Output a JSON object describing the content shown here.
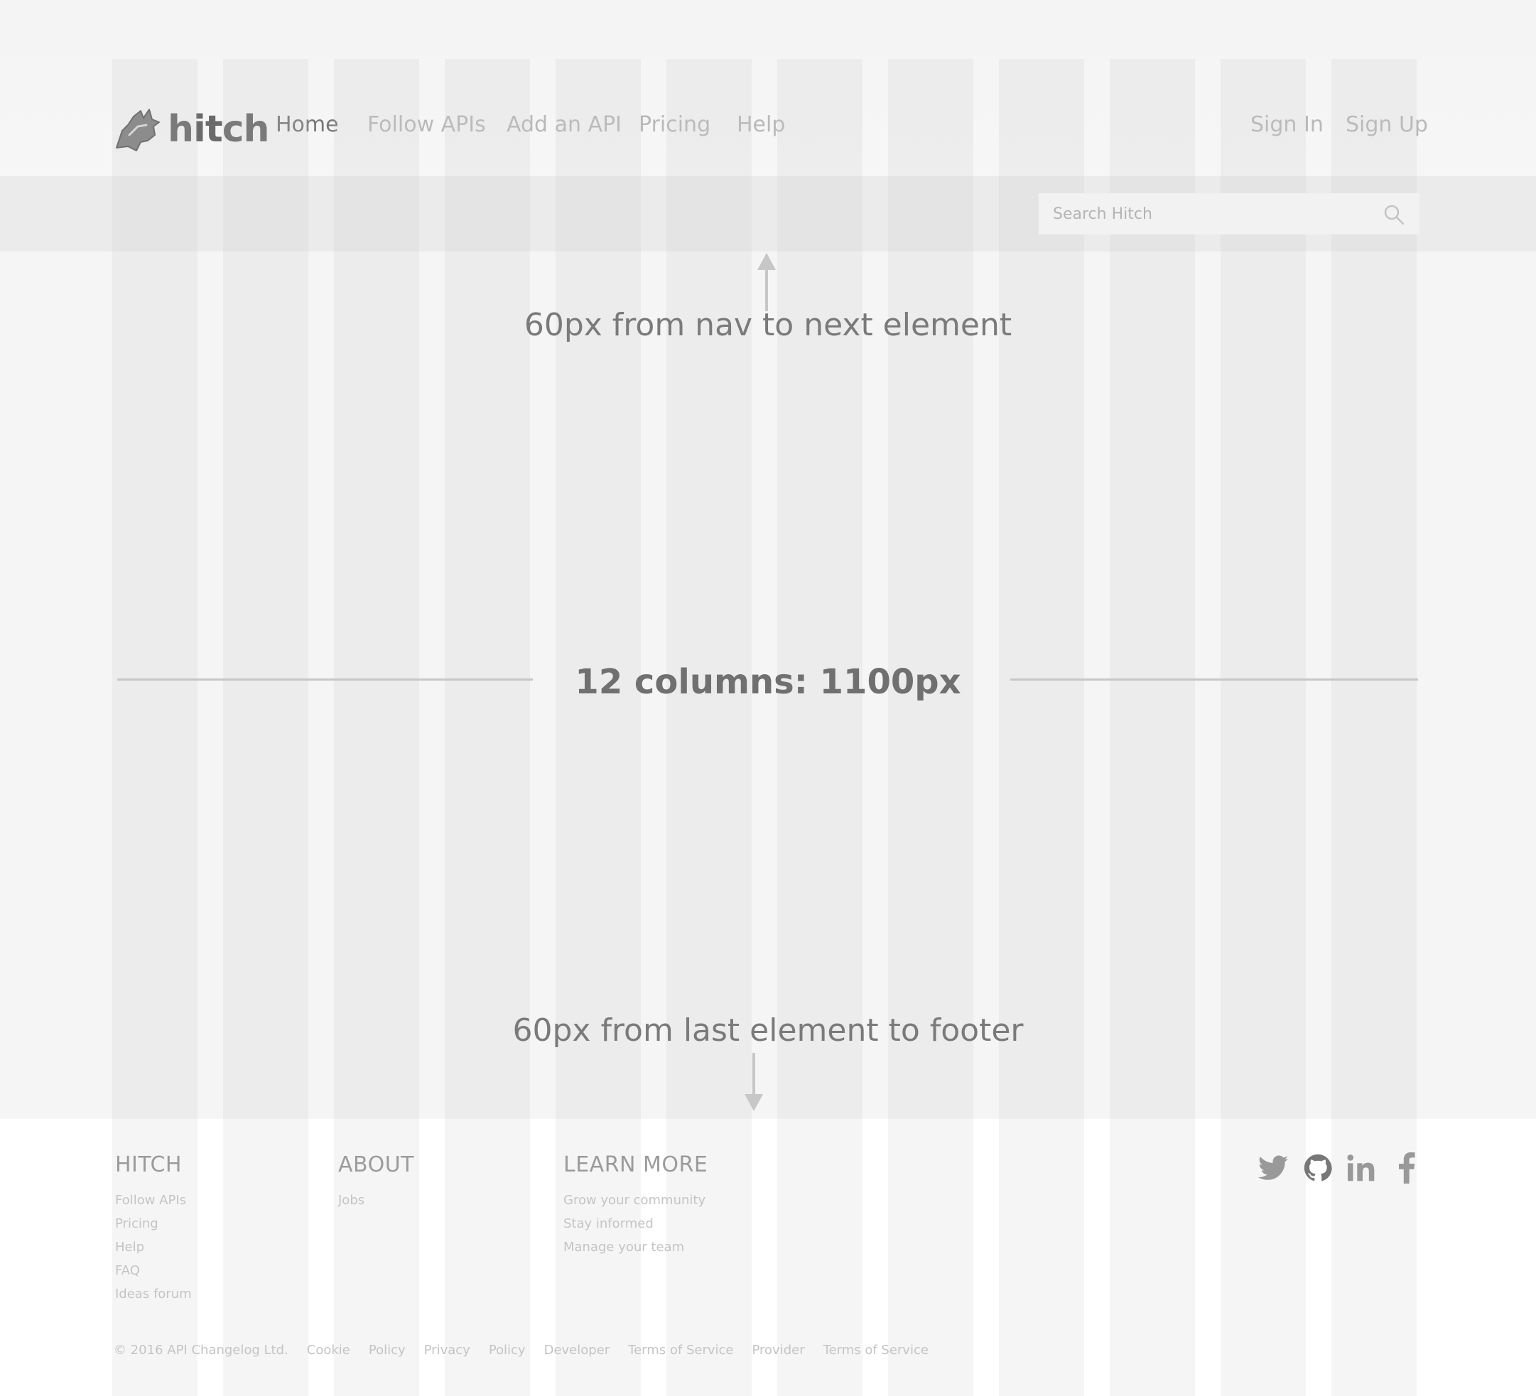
{
  "brand": {
    "name": "hitch"
  },
  "nav": {
    "items": [
      {
        "label": "Home",
        "active": true
      },
      {
        "label": "Follow APIs",
        "active": false
      },
      {
        "label": "Add an API",
        "active": false
      },
      {
        "label": "Pricing",
        "active": false
      },
      {
        "label": "Help",
        "active": false
      }
    ],
    "sign_in": "Sign In",
    "sign_up": "Sign Up"
  },
  "search": {
    "placeholder": "Search Hitch",
    "icon": "search-icon"
  },
  "annotations": {
    "top": "60px from nav to next element",
    "center": "12 columns: 1100px",
    "bottom": "60px from last element to footer"
  },
  "footer": {
    "columns": [
      {
        "heading": "HITCH",
        "links": [
          "Follow APIs",
          "Pricing",
          "Help",
          "FAQ",
          "Ideas forum"
        ]
      },
      {
        "heading": "ABOUT",
        "links": [
          "Jobs"
        ]
      },
      {
        "heading": "LEARN MORE",
        "links": [
          "Grow your community",
          "Stay informed",
          "Manage your team"
        ]
      }
    ],
    "socials": [
      "twitter-icon",
      "github-icon",
      "linkedin-icon",
      "facebook-icon"
    ],
    "legal": {
      "copyright": "© 2016 API Changelog Ltd.",
      "links": [
        "Cookie",
        "Policy",
        "Privacy",
        "Policy",
        "Developer",
        "Terms of Service",
        "Provider",
        "Terms of Service"
      ]
    }
  },
  "colors": {
    "background": "#f5f5f5",
    "grid_column": "#e6e6e6",
    "text_primary": "#777777",
    "text_muted": "#b9b9b9",
    "footer_background": "#ffffff"
  }
}
